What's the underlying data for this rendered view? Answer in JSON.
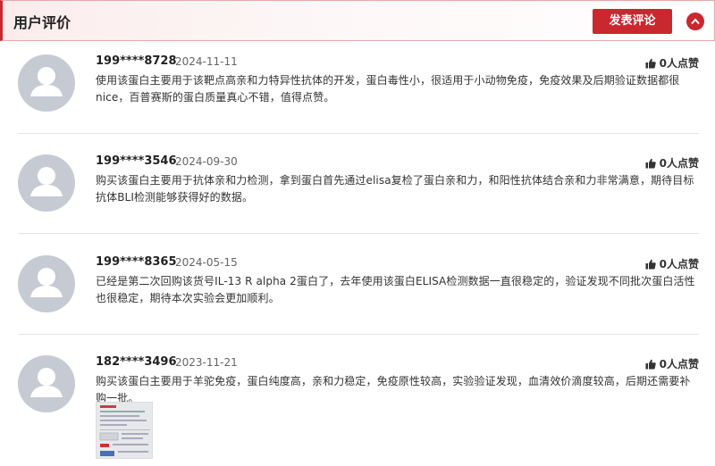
{
  "header": {
    "title": "用户评价",
    "post_button": "发表评论",
    "collapse_icon": "chevron-up-icon",
    "accent_color": "#c9282f"
  },
  "reviews": [
    {
      "user": "199****8728",
      "date": "2024-11-11",
      "likes": "0人点赞",
      "content": "使用该蛋白主要用于该靶点高亲和力特异性抗体的开发，蛋白毒性小，很适用于小动物免疫，免疫效果及后期验证数据都很nice，百普赛斯的蛋白质量真心不错，值得点赞。"
    },
    {
      "user": "199****3546",
      "date": "2024-09-30",
      "likes": "0人点赞",
      "content": "购买该蛋白主要用于抗体亲和力检测，拿到蛋白首先通过elisa复检了蛋白亲和力，和阳性抗体结合亲和力非常满意，期待目标抗体BLI检测能够获得好的数据。"
    },
    {
      "user": "199****8365",
      "date": "2024-05-15",
      "likes": "0人点赞",
      "content": "已经是第二次回购该货号IL-13 R alpha 2蛋白了，去年使用该蛋白ELISA检测数据一直很稳定的，验证发现不同批次蛋白活性也很稳定，期待本次实验会更加顺利。"
    },
    {
      "user": "182****3496",
      "date": "2023-11-21",
      "likes": "0人点赞",
      "content": "购买该蛋白主要用于羊驼免疫，蛋白纯度高，亲和力稳定，免疫原性较高，实验验证发现，血清效价滴度较高，后期还需要补购一批。",
      "has_image": true
    }
  ]
}
